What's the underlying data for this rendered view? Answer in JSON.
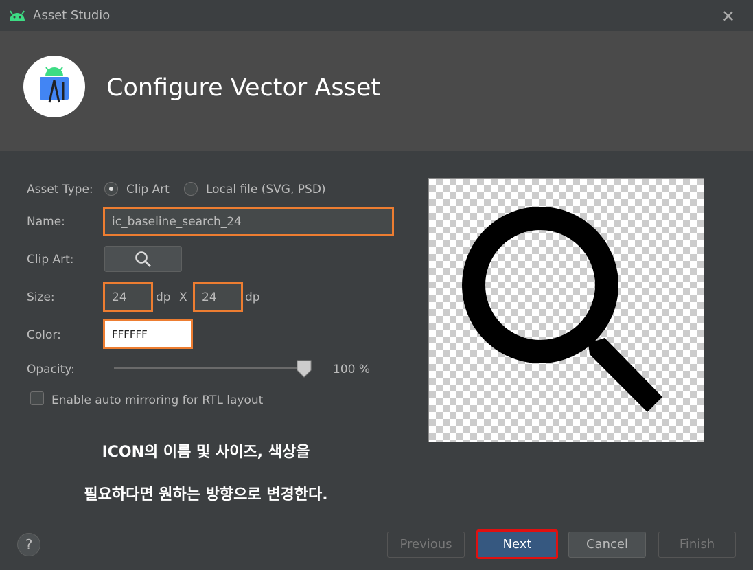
{
  "window": {
    "title": "Asset Studio"
  },
  "header": {
    "title": "Configure Vector Asset"
  },
  "form": {
    "asset_type_label": "Asset Type:",
    "clip_art_option": "Clip Art",
    "local_file_option": "Local file (SVG, PSD)",
    "name_label": "Name:",
    "name_value": "ic_baseline_search_24",
    "clip_art_label": "Clip Art:",
    "size_label": "Size:",
    "width_value": "24",
    "height_value": "24",
    "dp_unit": "dp",
    "times": "X",
    "color_label": "Color:",
    "color_value": "FFFFFF",
    "opacity_label": "Opacity:",
    "opacity_value": "100 %",
    "opacity_level": 1.0,
    "mirroring_label": "Enable auto mirroring for RTL layout",
    "mirroring_checked": false,
    "selected_asset_type": "Clip Art"
  },
  "annotation": {
    "line1": "ICON의 이름 및 사이즈, 색상을",
    "line2": "필요하다면 원하는 방향으로 변경한다."
  },
  "footer": {
    "help": "?",
    "previous": "Previous",
    "next": "Next",
    "cancel": "Cancel",
    "finish": "Finish"
  },
  "colors": {
    "highlight_orange": "#ed7d31",
    "highlight_red": "#e01010",
    "primary_button": "#365880"
  },
  "icons": {
    "app": "android-icon",
    "clip_art": "search-icon",
    "preview": "search-icon"
  }
}
